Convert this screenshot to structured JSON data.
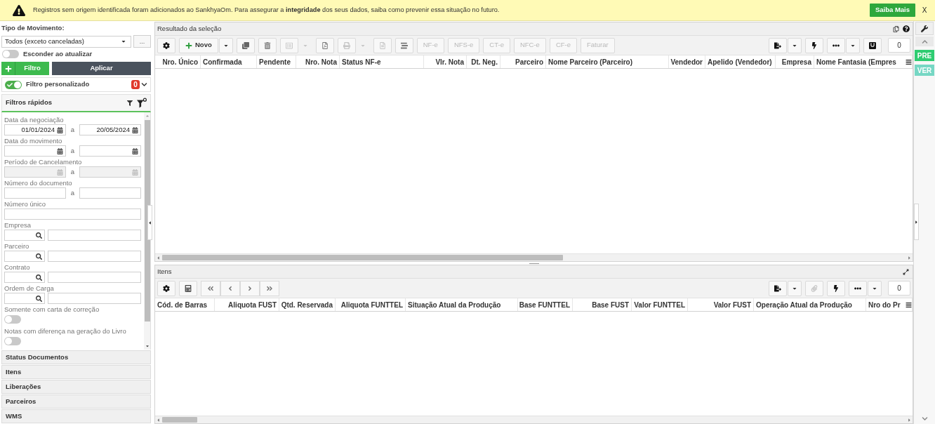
{
  "banner": {
    "message": "Registros sem origem identificada foram adicionados ao SankhyaOm. Para assegurar a **integridade** dos seus dados, saiba como prevenir essa situação no futuro.",
    "action": "Saiba Mais",
    "close": "X"
  },
  "filter_panel": {
    "movement_type": {
      "label": "Tipo de Movimento:",
      "value": "Todos (exceto canceladas)",
      "more": "..."
    },
    "hide_on_update": {
      "label": "Esconder ao atualizar",
      "on": false
    },
    "filter_button": "Filtro",
    "apply_button": "Aplicar",
    "custom_filter": {
      "label": "Filtro personalizado",
      "on": true,
      "count": "0"
    },
    "quick_filters": {
      "title": "Filtros rápidos",
      "fields": [
        {
          "kind": "date_range",
          "label": "Data da negociação",
          "from": "01/01/2024",
          "separator": "a",
          "to": "20/05/2024",
          "disabled": false
        },
        {
          "kind": "date_range",
          "label": "Data do movimento",
          "separator": "a",
          "disabled": false
        },
        {
          "kind": "date_range",
          "label": "Período de Cancelamento",
          "separator": "a",
          "disabled": true
        },
        {
          "kind": "range",
          "label": "Número do documento",
          "separator": "a"
        },
        {
          "kind": "text",
          "label": "Número único"
        },
        {
          "kind": "lookup",
          "label": "Empresa"
        },
        {
          "kind": "lookup",
          "label": "Parceiro"
        },
        {
          "kind": "lookup",
          "label": "Contrato"
        },
        {
          "kind": "lookup",
          "label": "Ordem de Carga"
        },
        {
          "kind": "toggle",
          "label": "Somente com carta de correção",
          "on": false
        },
        {
          "kind": "toggle",
          "label": "Notas com diferença na geração do Livro",
          "on": false
        }
      ]
    },
    "sections": [
      {
        "label": "Status Documentos"
      },
      {
        "label": "Itens"
      },
      {
        "label": "Liberações"
      },
      {
        "label": "Parceiros"
      },
      {
        "label": "WMS"
      }
    ]
  },
  "results": {
    "title": "Resultado da seleção",
    "toolbar": [
      {
        "kind": "icon",
        "disabled": false,
        "dropdown": false
      },
      {
        "kind": "text",
        "label": "Novo",
        "disabled": false,
        "dropdown": true
      },
      {
        "kind": "icon",
        "disabled": false,
        "dropdown": false
      },
      {
        "kind": "icon",
        "disabled": false,
        "dropdown": false
      },
      {
        "kind": "icon",
        "disabled": true,
        "dropdown": true
      },
      {
        "kind": "icon",
        "disabled": false,
        "dropdown": false
      },
      {
        "kind": "icon",
        "disabled": true,
        "dropdown": true
      },
      {
        "kind": "icon",
        "disabled": true,
        "dropdown": false
      },
      {
        "kind": "icon",
        "disabled": false,
        "dropdown": false
      },
      {
        "kind": "text",
        "label": "NF-e",
        "disabled": true,
        "dropdown": false
      },
      {
        "kind": "text",
        "label": "NFS-e",
        "disabled": true,
        "dropdown": false
      },
      {
        "kind": "text",
        "label": "CT-e",
        "disabled": true,
        "dropdown": false
      },
      {
        "kind": "text",
        "label": "NFC-e",
        "disabled": true,
        "dropdown": false
      },
      {
        "kind": "text",
        "label": "CF-e",
        "disabled": true,
        "dropdown": false
      },
      {
        "kind": "text",
        "label": "Faturar",
        "disabled": true,
        "dropdown": false
      }
    ],
    "toolbar_right": [
      {
        "kind": "icon",
        "disabled": false,
        "dropdown": true
      },
      {
        "kind": "icon",
        "disabled": false,
        "dropdown": false
      },
      {
        "kind": "icon",
        "disabled": false,
        "dropdown": true
      },
      {
        "kind": "icon",
        "disabled": false,
        "dropdown": false
      }
    ],
    "counter": "0",
    "columns": [
      {
        "label": "Nro. Único",
        "right_aligned": true
      },
      {
        "label": "Confirmada",
        "right_aligned": false
      },
      {
        "label": "Pendente",
        "right_aligned": false
      },
      {
        "label": "Nro. Nota",
        "right_aligned": true
      },
      {
        "label": "Status NF-e",
        "right_aligned": false
      },
      {
        "label": "Vlr. Nota",
        "right_aligned": true
      },
      {
        "label": "Dt. Neg.",
        "right_aligned": true
      },
      {
        "label": "Parceiro",
        "right_aligned": true
      },
      {
        "label": "Nome Parceiro (Parceiro)",
        "right_aligned": false
      },
      {
        "label": "Vendedor",
        "right_aligned": true
      },
      {
        "label": "Apelido (Vendedor)",
        "right_aligned": false
      },
      {
        "label": "Empresa",
        "right_aligned": true
      },
      {
        "label": "Nome Fantasia (Empres",
        "right_aligned": false
      }
    ]
  },
  "items": {
    "title": "Itens",
    "toolbar": [
      {
        "kind": "icon",
        "disabled": false
      },
      {
        "kind": "icon",
        "disabled": false
      },
      {
        "kind": "nav",
        "disabled": false
      },
      {
        "kind": "nav",
        "disabled": false
      },
      {
        "kind": "nav",
        "disabled": false
      },
      {
        "kind": "nav",
        "disabled": false
      }
    ],
    "toolbar_right": [
      {
        "kind": "icon",
        "disabled": false,
        "dropdown": true
      },
      {
        "kind": "icon",
        "disabled": true,
        "dropdown": false
      },
      {
        "kind": "icon",
        "disabled": false,
        "dropdown": false
      },
      {
        "kind": "icon",
        "disabled": false,
        "dropdown": true
      }
    ],
    "counter": "0",
    "columns": [
      {
        "label": "Cód. de Barras",
        "right_aligned": false
      },
      {
        "label": "Aliquota FUST",
        "right_aligned": true
      },
      {
        "label": "Qtd. Reservada",
        "right_aligned": true
      },
      {
        "label": "Aliquota FUNTTEL",
        "right_aligned": true
      },
      {
        "label": "Situação Atual da Produção",
        "right_aligned": false
      },
      {
        "label": "Base FUNTTEL",
        "right_aligned": true
      },
      {
        "label": "Base FUST",
        "right_aligned": true
      },
      {
        "label": "Valor FUNTTEL",
        "right_aligned": true
      },
      {
        "label": "Valor FUST",
        "right_aligned": true
      },
      {
        "label": "Operação Atual da Produção",
        "right_aligned": false
      },
      {
        "label": "Nro do Pr",
        "right_aligned": false
      }
    ]
  },
  "side_bar": {
    "tags": [
      {
        "label": "PRE",
        "color": "#2ecc71"
      },
      {
        "label": "VER",
        "color": "#76d7c4"
      }
    ]
  }
}
